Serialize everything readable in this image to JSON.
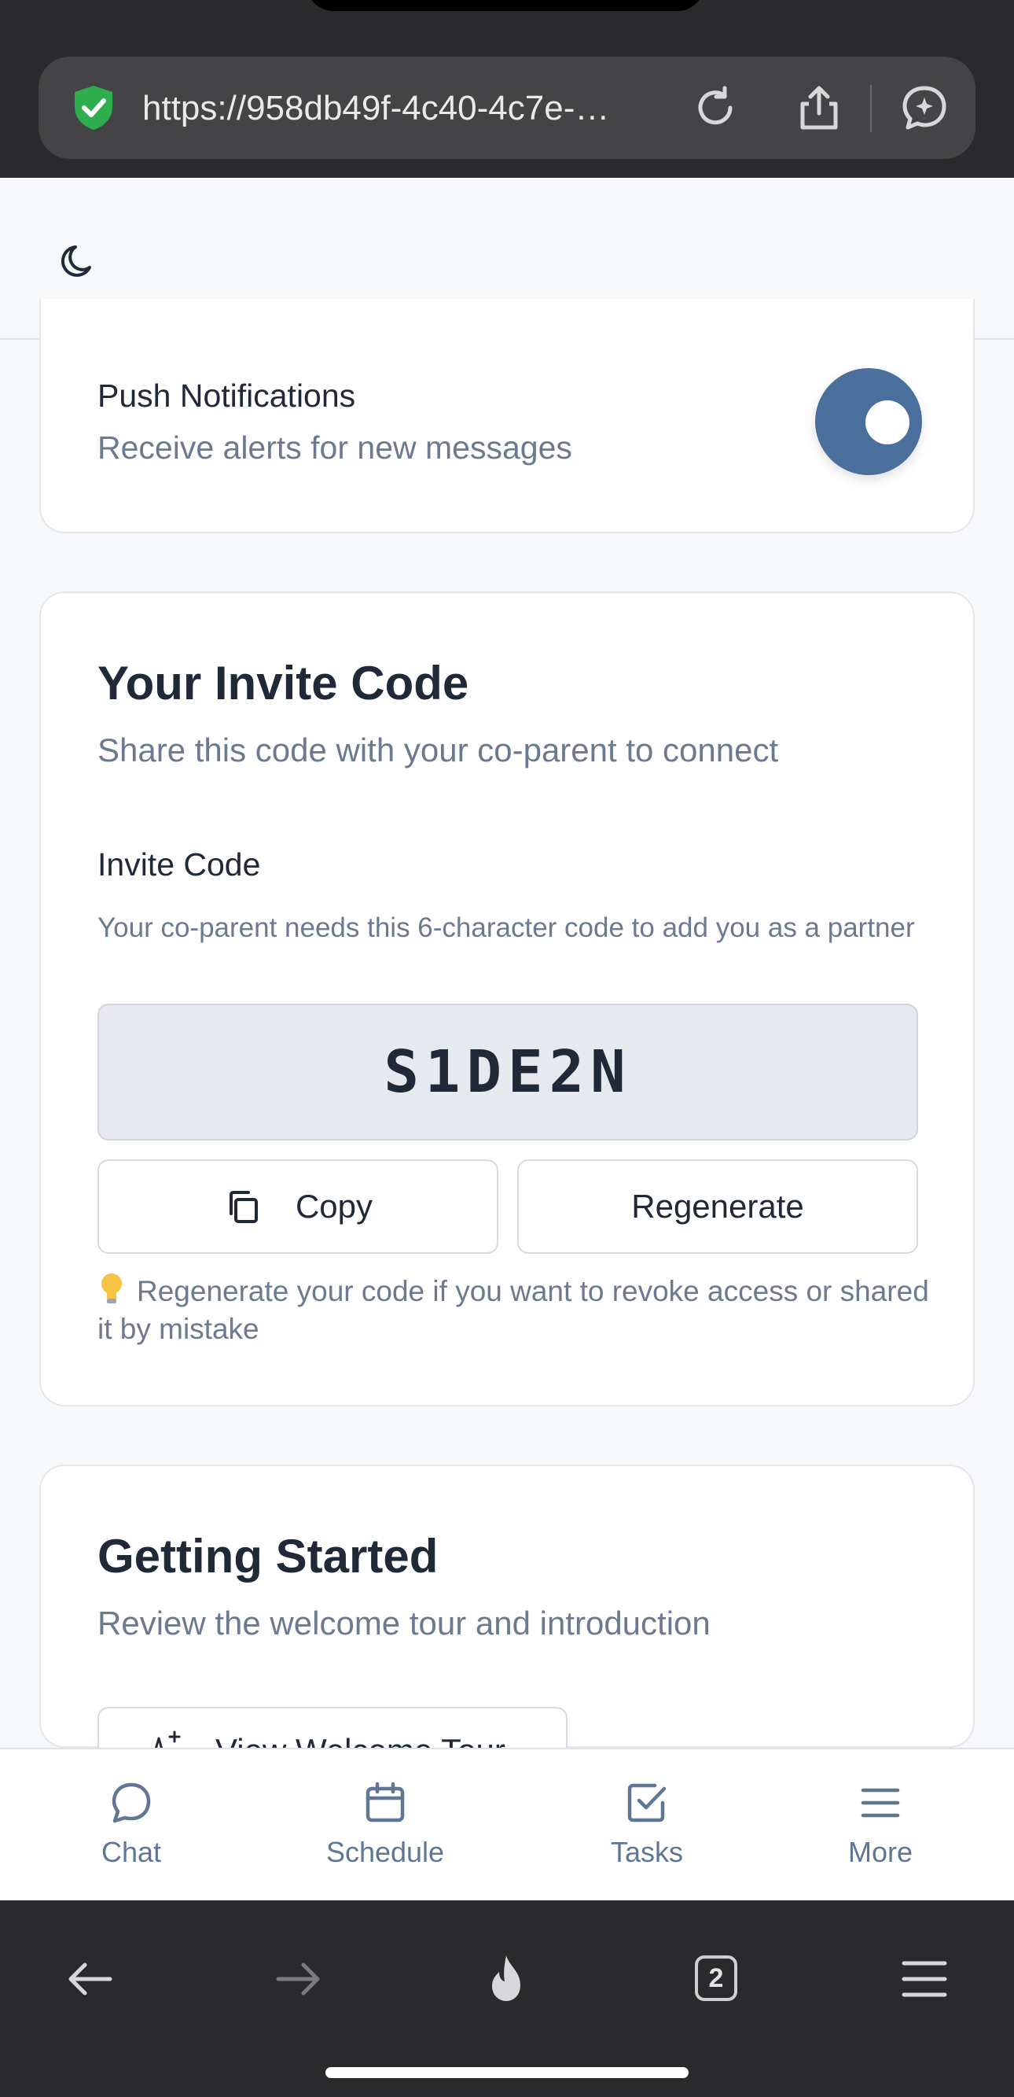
{
  "browser": {
    "url": "https://958db49f-4c40-4c7e-…",
    "tab_count": "2",
    "icons": [
      "shield-check-icon",
      "reload-icon",
      "share-icon",
      "assistant-icon",
      "back-icon",
      "forward-icon",
      "fire-icon",
      "tabs-icon",
      "menu-icon"
    ]
  },
  "header": {
    "theme_icon": "moon-icon"
  },
  "push_card": {
    "title": "Push Notifications",
    "description": "Receive alerts for new messages",
    "toggle_on": true
  },
  "invite_card": {
    "title": "Your Invite Code",
    "subtitle": "Share this code with your co-parent to connect",
    "label": "Invite Code",
    "help": "Your co-parent needs this 6-character code to add you as a partner",
    "code": "S1DE2N",
    "copy_label": "Copy",
    "regenerate_label": "Regenerate",
    "tip": "Regenerate your code if you want to revoke access or shared it by mistake"
  },
  "getting_started": {
    "title": "Getting Started",
    "subtitle": "Review the welcome tour and introduction",
    "tour_button": "View Welcome Tour"
  },
  "nav": {
    "items": [
      {
        "label": "Chat",
        "icon": "chat-bubble-icon"
      },
      {
        "label": "Schedule",
        "icon": "calendar-icon"
      },
      {
        "label": "Tasks",
        "icon": "check-square-icon"
      },
      {
        "label": "More",
        "icon": "hamburger-icon"
      }
    ]
  },
  "colors": {
    "accent": "#4a6f9c",
    "nav_text": "#5f7694",
    "muted_text": "#6b7a90",
    "browser_chrome": "#2a2a2c"
  }
}
